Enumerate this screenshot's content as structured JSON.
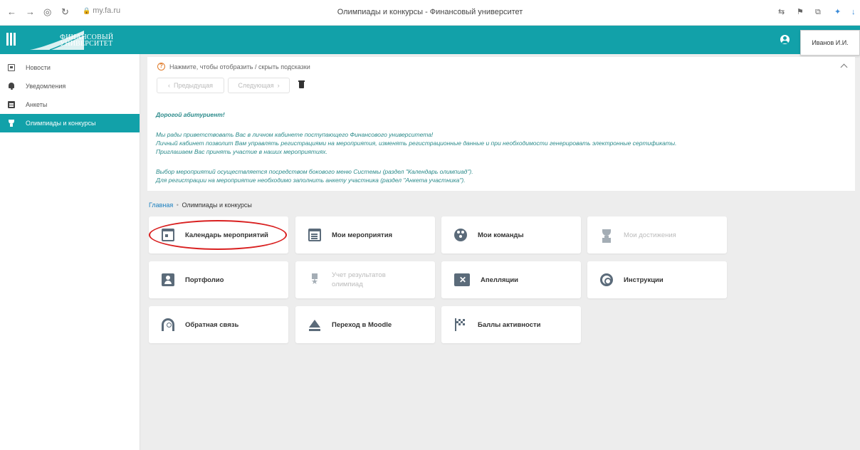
{
  "browser": {
    "url": "my.fa.ru",
    "title": "Олимпиады и конкурсы - Финансовый университет"
  },
  "header": {
    "logo_line1": "ФИНАНСОВЫЙ",
    "logo_line2": "УНИВЕРСИТЕТ",
    "user_name": "Иванов И.И.",
    "accent_color": "#12a1a9"
  },
  "sidebar": {
    "items": [
      {
        "label": "Новости",
        "icon": "newspaper-icon"
      },
      {
        "label": "Уведомления",
        "icon": "bell-icon"
      },
      {
        "label": "Анкеты",
        "icon": "form-icon"
      },
      {
        "label": "Олимпиады и конкурсы",
        "icon": "trophy-icon",
        "active": true
      }
    ]
  },
  "hints": {
    "toggle_label": "Нажмите, чтобы отобразить / скрыть подсказки",
    "prev_label": "Предыдущая",
    "next_label": "Следующая",
    "greeting": "Дорогой абитуриент!",
    "lines": [
      "Мы рады приветствовать Вас в личном кабинете поступающего Финансового университета!",
      "Личный кабинет позволит Вам управлять регистрациями на мероприятия, изменять регистрационные данные и при необходимости генерировать электронные сертификаты.",
      "Приглашаем Вас принять участие в наших мероприятиях.",
      "Выбор мероприятий осуществляется посредством бокового меню Системы (раздел \"Календарь олимпиад\").",
      "Для регистрации на мероприятие необходимо заполнить анкету участника (раздел \"Анкета участника\")."
    ]
  },
  "breadcrumb": {
    "home": "Главная",
    "separator": "•",
    "current": "Олимпиады и конкурсы"
  },
  "cards": [
    {
      "label": "Календарь мероприятий",
      "icon": "calendar-icon",
      "enabled": true
    },
    {
      "label": "Мои мероприятия",
      "icon": "document-icon",
      "enabled": true
    },
    {
      "label": "Мои команды",
      "icon": "team-icon",
      "enabled": true
    },
    {
      "label": "Мои достижения",
      "icon": "trophy-icon",
      "enabled": false
    },
    {
      "label": "Портфолио",
      "icon": "portfolio-icon",
      "enabled": true
    },
    {
      "label": "Учет результатов олимпиад",
      "icon": "medal-icon",
      "enabled": false
    },
    {
      "label": "Апелляции",
      "icon": "close-box-icon",
      "enabled": true
    },
    {
      "label": "Инструкции",
      "icon": "lifebuoy-icon",
      "enabled": true
    },
    {
      "label": "Обратная связь",
      "icon": "feedback-icon",
      "enabled": true
    },
    {
      "label": "Переход в Moodle",
      "icon": "eject-icon",
      "enabled": true
    },
    {
      "label": "Баллы активности",
      "icon": "checkered-flag-icon",
      "enabled": true
    }
  ],
  "highlight_color": "#d92020"
}
